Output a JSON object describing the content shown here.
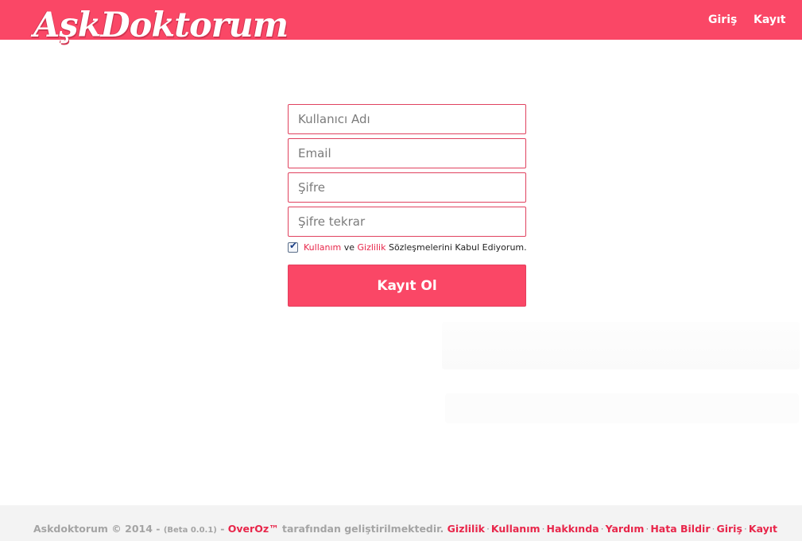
{
  "header": {
    "logo_text": "AşkDoktorum",
    "nav": {
      "login": "Giriş",
      "register": "Kayıt"
    },
    "brand_color": "#fa4766"
  },
  "form": {
    "username_placeholder": "Kullanıcı Adı",
    "email_placeholder": "Email",
    "password_placeholder": "Şifre",
    "password_repeat_placeholder": "Şifre tekrar",
    "terms_checked": true,
    "terms_link_usage": "Kullanım",
    "terms_and": "ve",
    "terms_link_privacy": "Gizlilik",
    "terms_suffix": "Sözleşmelerini Kabul Ediyorum.",
    "submit_label": "Kayıt Ol"
  },
  "footer": {
    "copyright": "Askdoktorum © 2014 -",
    "version": "(Beta 0.0.1)",
    "dash": "-",
    "developer": "OverOz™",
    "developed_by": "tarafından geliştirilmektedir.",
    "links": [
      "Gizlilik",
      "Kullanım",
      "Hakkında",
      "Yardım",
      "Hata Bildir",
      "Giriş",
      "Kayıt"
    ],
    "separator": "·"
  }
}
